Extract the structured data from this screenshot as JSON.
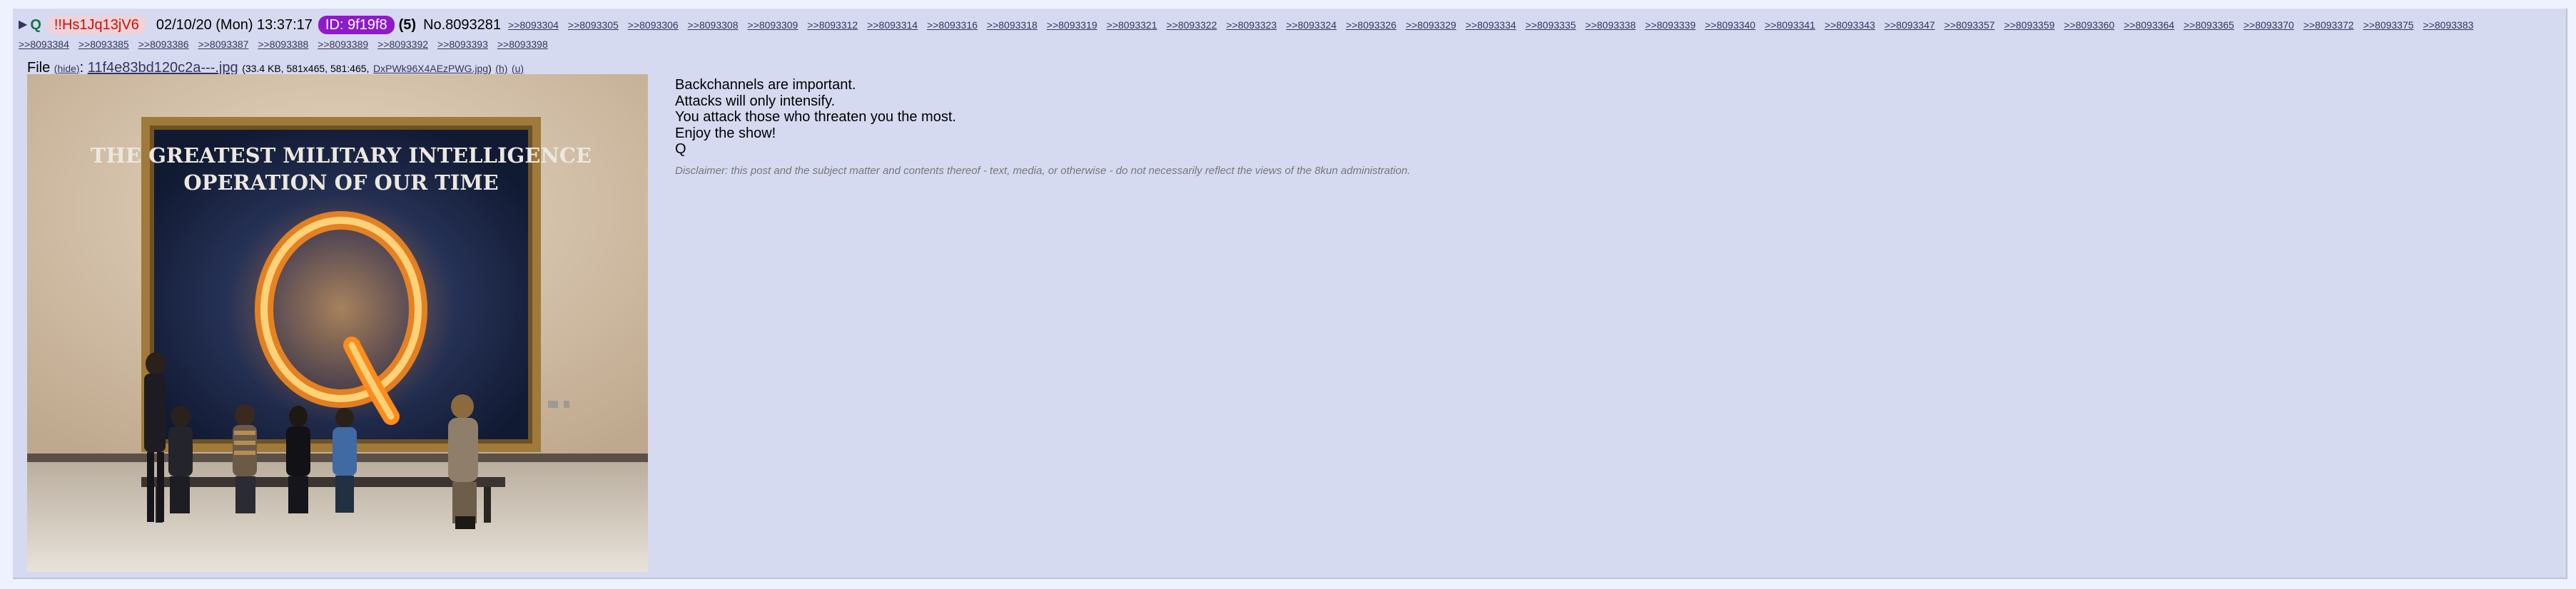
{
  "post": {
    "arrow": "▶",
    "q": "Q",
    "tripcode": "!!Hs1Jq13jV6",
    "datetime": "02/10/20 (Mon) 13:37:17",
    "id_badge": "ID: 9f19f8",
    "reply_count": "(5)",
    "post_number": "No.8093281",
    "backlinks_row1": [
      ">>8093304",
      ">>8093305",
      ">>8093306",
      ">>8093308",
      ">>8093309",
      ">>8093312",
      ">>8093314",
      ">>8093316",
      ">>8093318",
      ">>8093319",
      ">>8093321",
      ">>8093322",
      ">>8093323",
      ">>8093324",
      ">>8093326",
      ">>8093329",
      ">>8093334",
      ">>8093335",
      ">>8093338",
      ">>8093339",
      ">>8093340",
      ">>8093341",
      ">>8093343",
      ">>8093347",
      ">>8093357",
      ">>8093359",
      ">>8093360",
      ">>8093364",
      ">>8093365",
      ">>8093370",
      ">>8093372",
      ">>8093375",
      ">>8093383"
    ],
    "backlinks_row2": [
      ">>8093384",
      ">>8093385",
      ">>8093386",
      ">>8093387",
      ">>8093388",
      ">>8093389",
      ">>8093392",
      ">>8093393",
      ">>8093398"
    ]
  },
  "file": {
    "label": "File",
    "hide": "(hide)",
    "colon": ":",
    "filename": "11f4e83bd120c2a---.jpg",
    "meta": "(33.4 KB, 581x465, 581:465,",
    "orig_name": "DxPWk96X4AEzPWG.jpg",
    "meta_close": ")",
    "h": "(h)",
    "u": "(u)"
  },
  "image": {
    "caption_line1": "THE GREATEST MILITARY INTELLIGENCE",
    "caption_line2": "OPERATION OF OUR TIME",
    "letter": "Q"
  },
  "message": {
    "lines": [
      "Backchannels are important.",
      "Attacks will only intensify.",
      "You attack those who threaten you the most.",
      "Enjoy the show!",
      "Q"
    ],
    "disclaimer": "Disclaimer: this post and the subject matter and contents thereof - text, media, or otherwise - do not necessarily reflect the views of the 8kun administration."
  },
  "colors": {
    "post_bg": "#d6daf0",
    "trip_red": "#cc1105",
    "id_purple": "#8e1ac9",
    "link": "#34345c"
  }
}
